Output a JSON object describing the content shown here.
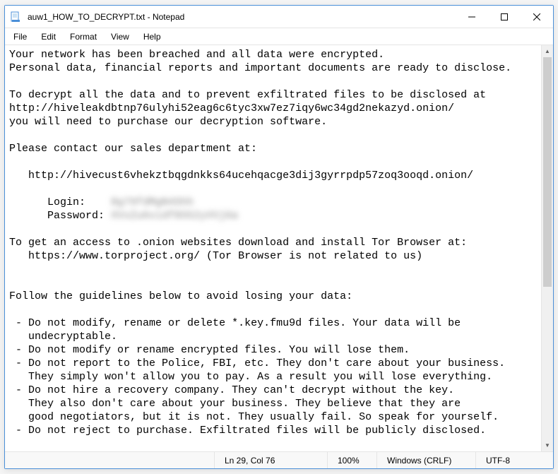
{
  "window": {
    "title": "auw1_HOW_TO_DECRYPT.txt - Notepad"
  },
  "menubar": {
    "items": [
      "File",
      "Edit",
      "Format",
      "View",
      "Help"
    ]
  },
  "body": {
    "l1": "Your network has been breached and all data were encrypted.",
    "l2": "Personal data, financial reports and important documents are ready to disclose.",
    "l3": "",
    "l4": "To decrypt all the data and to prevent exfiltrated files to be disclosed at",
    "l5": "http://hiveleakdbtnp76ulyhi52eag6c6tyc3xw7ez7iqy6wc34gd2nekazyd.onion/",
    "l6": "you will need to purchase our decryption software.",
    "l7": "",
    "l8": "Please contact our sales department at:",
    "l9": "",
    "l10": "   http://hivecust6vhekztbqgdnkks64ucehqacge3dij3gyrrpdp57zoq3ooqd.onion/",
    "l11": "",
    "l12a": "      Login:    ",
    "l12b": "8g79fdMgN4Shh",
    "l13a": "      Password: ",
    "l13b": "XVxZu6vidf8S52yVVj6a",
    "l14": "",
    "l15": "To get an access to .onion websites download and install Tor Browser at:",
    "l16": "   https://www.torproject.org/ (Tor Browser is not related to us)",
    "l17": "",
    "l18": "",
    "l19": "Follow the guidelines below to avoid losing your data:",
    "l20": "",
    "l21": " - Do not modify, rename or delete *.key.fmu9d files. Your data will be",
    "l22": "   undecryptable.",
    "l23": " - Do not modify or rename encrypted files. You will lose them.",
    "l24": " - Do not report to the Police, FBI, etc. They don't care about your business.",
    "l25": "   They simply won't allow you to pay. As a result you will lose everything.",
    "l26": " - Do not hire a recovery company. They can't decrypt without the key.",
    "l27": "   They also don't care about your business. They believe that they are",
    "l28": "   good negotiators, but it is not. They usually fail. So speak for yourself.",
    "l29": " - Do not reject to purchase. Exfiltrated files will be publicly disclosed."
  },
  "statusbar": {
    "position": "Ln 29, Col 76",
    "zoom": "100%",
    "line_ending": "Windows (CRLF)",
    "encoding": "UTF-8"
  }
}
